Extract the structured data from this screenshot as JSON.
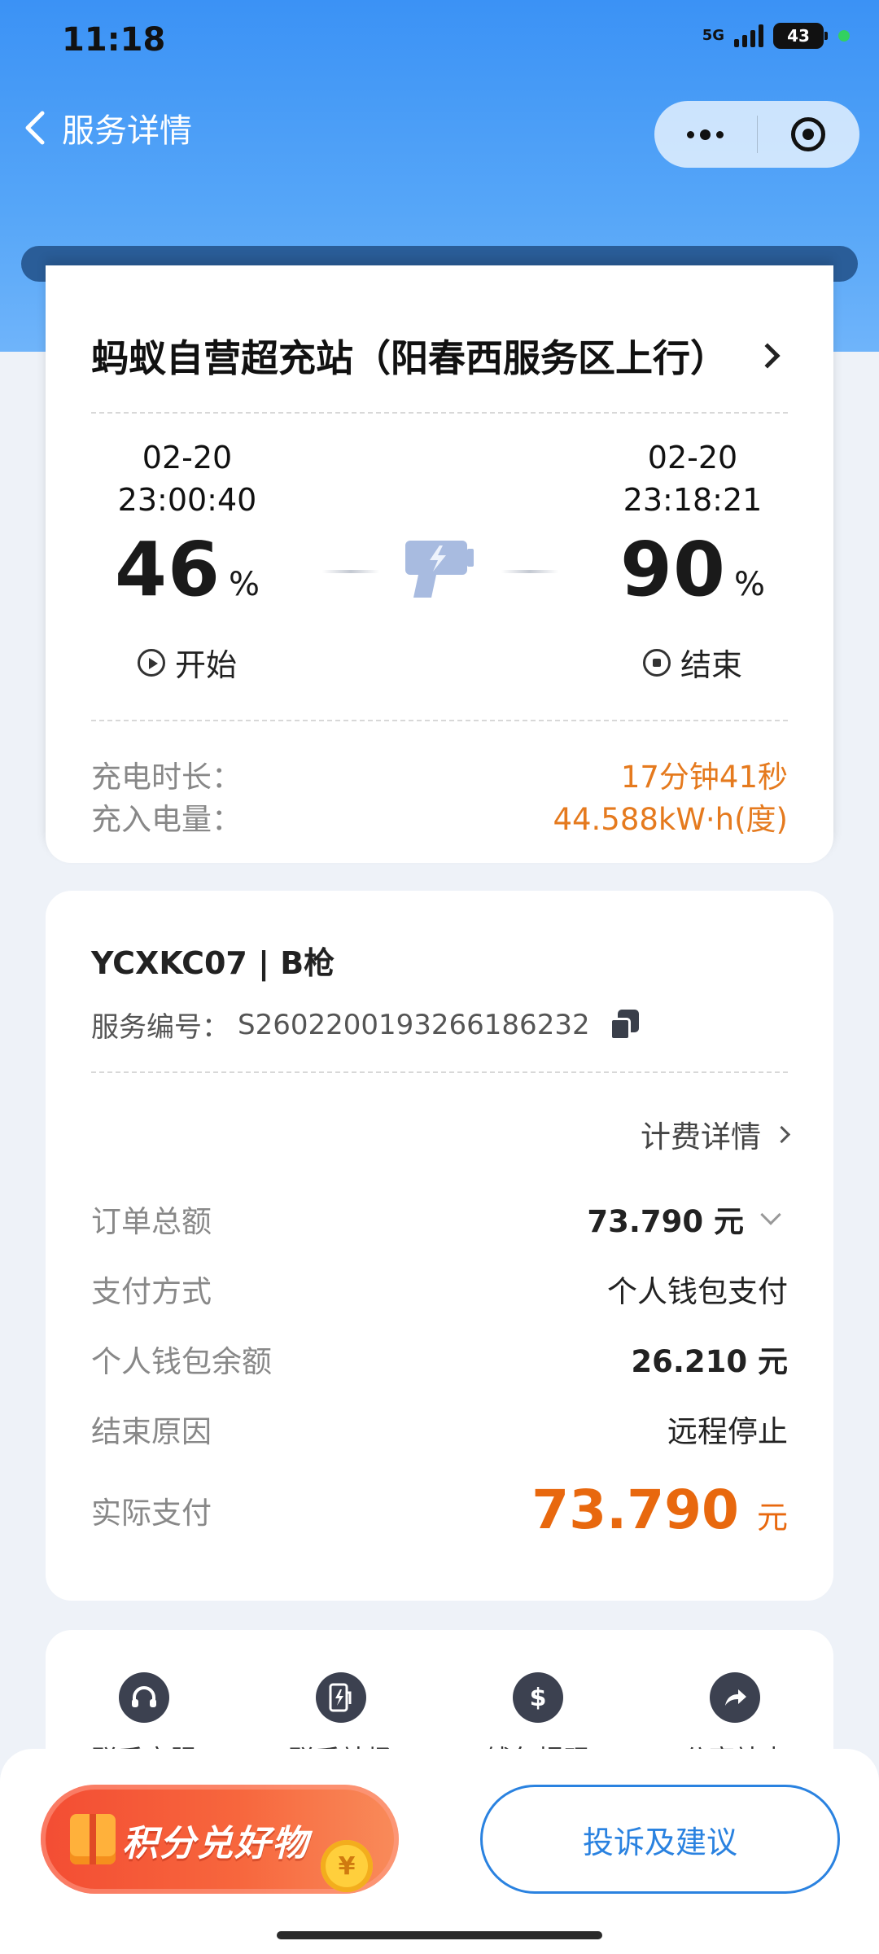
{
  "status_bar": {
    "time": "11:18",
    "network": "5G",
    "battery": "43"
  },
  "nav": {
    "title": "服务详情"
  },
  "station": {
    "name": "蚂蚁自营超充站（阳春西服务区上行）",
    "start": {
      "date": "02-20",
      "time": "23:00:40",
      "percent": "46",
      "unit": "%",
      "label": "开始"
    },
    "end": {
      "date": "02-20",
      "time": "23:18:21",
      "percent": "90",
      "unit": "%",
      "label": "结束"
    },
    "duration_label": "充电时长：",
    "duration_value": "17分钟41秒",
    "energy_label": "充入电量：",
    "energy_value": "44.588kW·h(度)"
  },
  "service": {
    "gun": "YCXKC07 | B枪",
    "sn_label": "服务编号：",
    "sn_value": "S2602200193266186232",
    "billing_link": "计费详情",
    "rows": [
      {
        "label": "订单总额",
        "value": "73.790 元"
      },
      {
        "label": "支付方式",
        "value": "个人钱包支付"
      },
      {
        "label": "个人钱包余额",
        "value": "26.210 元"
      },
      {
        "label": "结束原因",
        "value": "远程停止"
      }
    ],
    "actual_label": "实际支付",
    "actual_amount": "73.790",
    "actual_currency": "元"
  },
  "actions": [
    {
      "label": "联系客服",
      "icon": "headset-icon"
    },
    {
      "label": "联系站场",
      "icon": "charger-icon"
    },
    {
      "label": "钱包提现",
      "icon": "money-icon"
    },
    {
      "label": "分享站点",
      "icon": "share-icon"
    }
  ],
  "bottom": {
    "promo": "积分兑好物",
    "complaint": "投诉及建议"
  },
  "colors": {
    "accent_blue": "#2a82e0",
    "orange": "#e8680e",
    "header": "#3b92f5"
  }
}
